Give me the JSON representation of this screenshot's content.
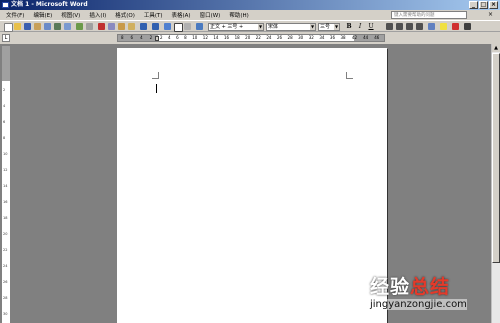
{
  "window": {
    "title": "文档 1 - Microsoft Word"
  },
  "menubar": {
    "items": [
      "文件(F)",
      "编辑(E)",
      "视图(V)",
      "插入(I)",
      "格式(O)",
      "工具(T)",
      "表格(A)",
      "窗口(W)",
      "帮助(H)"
    ],
    "help_placeholder": "键入需要帮助的问题"
  },
  "toolbar": {
    "style_value": "正文 + 三号 +",
    "font_value": "宋体",
    "size_value": "三号",
    "bold": "B",
    "italic": "I",
    "underline": "U"
  },
  "ruler": {
    "left_numbers": [
      "8",
      "6",
      "4",
      "2"
    ],
    "numbers": [
      "2",
      "4",
      "6",
      "8",
      "10",
      "12",
      "14",
      "16",
      "18",
      "20",
      "22",
      "24",
      "26",
      "28",
      "30",
      "32",
      "34",
      "36",
      "38"
    ],
    "right_numbers": [
      "42",
      "44",
      "46"
    ]
  },
  "vruler": {
    "numbers": [
      "2",
      "4",
      "6",
      "8",
      "10",
      "12",
      "14",
      "16",
      "18",
      "20",
      "22",
      "24",
      "26",
      "28",
      "30"
    ]
  },
  "watermark": {
    "logo_a": "经验",
    "logo_b": "总结",
    "url": "jingyanzongjie.com"
  }
}
